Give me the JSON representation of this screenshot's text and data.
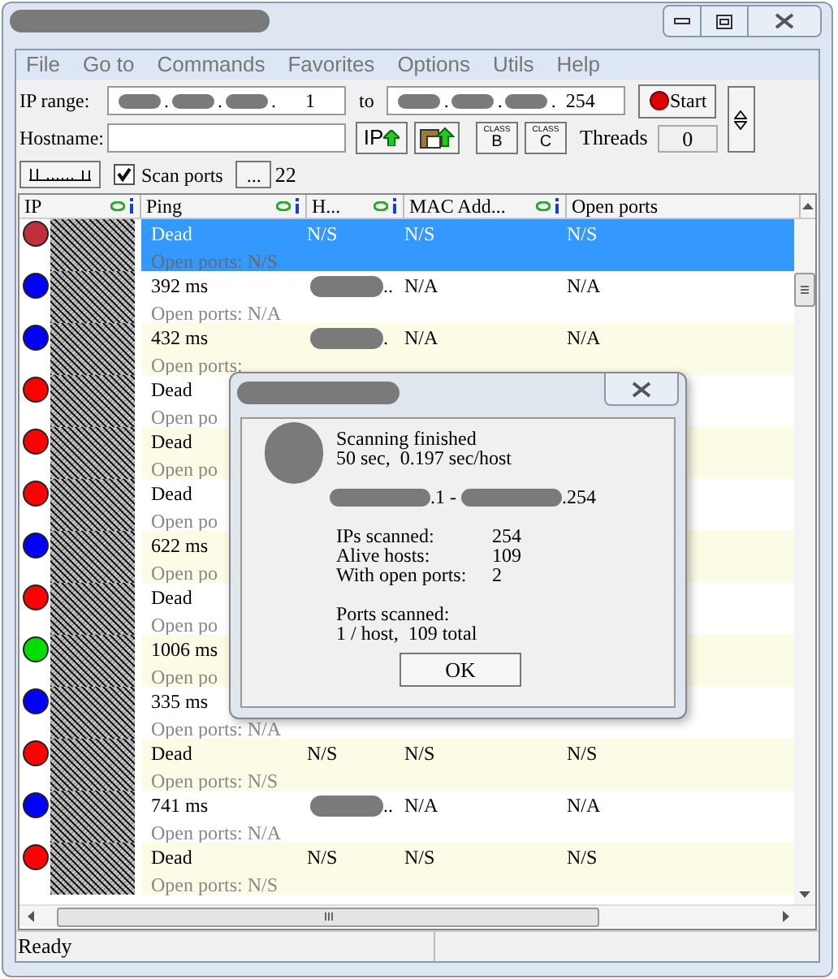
{
  "menu": [
    "File",
    "Go to",
    "Commands",
    "Favorites",
    "Options",
    "Utils",
    "Help"
  ],
  "toolbar": {
    "ip_range_label": "IP range:",
    "ip_separator": ".",
    "range_start_last": "1",
    "to_label": "to",
    "range_end_last": "254",
    "start_button": "Start",
    "hostname_label": "Hostname:",
    "ip_button": "IP",
    "class_b": {
      "caption": "CLASS",
      "letter": "B"
    },
    "class_c": {
      "caption": "CLASS",
      "letter": "C"
    },
    "threads_label": "Threads",
    "threads": "0",
    "scan_ports": {
      "label": "Scan ports",
      "checked": true
    },
    "ports_button": "...",
    "ports": "22"
  },
  "columns": [
    {
      "label": "IP",
      "kind": "feeder"
    },
    {
      "label": "Ping",
      "kind": "fetcher"
    },
    {
      "label": "H...",
      "kind": "fetcher"
    },
    {
      "label": "MAC Add...",
      "kind": "fetcher"
    },
    {
      "label": "Open ports",
      "kind": "plain"
    }
  ],
  "rows": [
    {
      "color": "#c0303a",
      "selected": true,
      "ping": "Dead",
      "hostname": "N/S",
      "mac": "N/S",
      "ports": "N/S",
      "ports_line": "Open ports: N/S"
    },
    {
      "color": "#0000ff",
      "selected": false,
      "ping": "392 ms",
      "hostname_redacted": true,
      "hostname": "..",
      "mac": "N/A",
      "ports": "N/A",
      "ports_line": "Open ports: N/A"
    },
    {
      "color": "#0000ff",
      "selected": false,
      "ping": "432 ms",
      "hostname_redacted": true,
      "hostname": ".",
      "mac": "N/A",
      "ports": "N/A",
      "ports_line": "Open ports:"
    },
    {
      "color": "#ff0000",
      "selected": false,
      "ping": "Dead",
      "ports_line": "Open po"
    },
    {
      "color": "#ff0000",
      "selected": false,
      "ping": "Dead",
      "ports_line": "Open po"
    },
    {
      "color": "#ff0000",
      "selected": false,
      "ping": "Dead",
      "ports_line": "Open po"
    },
    {
      "color": "#0000ff",
      "selected": false,
      "ping": "622 ms",
      "ports_line": "Open po"
    },
    {
      "color": "#ff0000",
      "selected": false,
      "ping": "Dead",
      "ports_line": "Open po"
    },
    {
      "color": "#00dd00",
      "selected": false,
      "ping": "1006 ms",
      "ports_line": "Open po"
    },
    {
      "color": "#0000ff",
      "selected": false,
      "ping": "335 ms",
      "ports_line": "Open ports: N/A"
    },
    {
      "color": "#ff0000",
      "selected": false,
      "ping": "Dead",
      "hostname": "N/S",
      "mac": "N/S",
      "ports": "N/S",
      "ports_line": "Open ports: N/S"
    },
    {
      "color": "#0000ff",
      "selected": false,
      "ping": "741 ms",
      "hostname_redacted": true,
      "hostname": "..",
      "mac": "N/A",
      "ports": "N/A",
      "ports_line": "Open ports: N/A"
    },
    {
      "color": "#ff0000",
      "selected": false,
      "ping": "Dead",
      "hostname": "N/S",
      "mac": "N/S",
      "ports": "N/S",
      "ports_line": "Open ports: N/S"
    }
  ],
  "dialog": {
    "message": "Scanning finished",
    "timing": "50 sec,  0.197 sec/host",
    "range_start_tail": ".1 - ",
    "range_end_tail": ".254",
    "stats": [
      {
        "label": "IPs scanned:",
        "value": "254"
      },
      {
        "label": "Alive hosts:",
        "value": "109"
      },
      {
        "label": "With open ports:",
        "value": "2"
      }
    ],
    "ports_label": "Ports scanned:",
    "ports_summary": "1 / host,  109 total",
    "ok_button": "OK"
  },
  "status_bar": [
    "Ready"
  ]
}
